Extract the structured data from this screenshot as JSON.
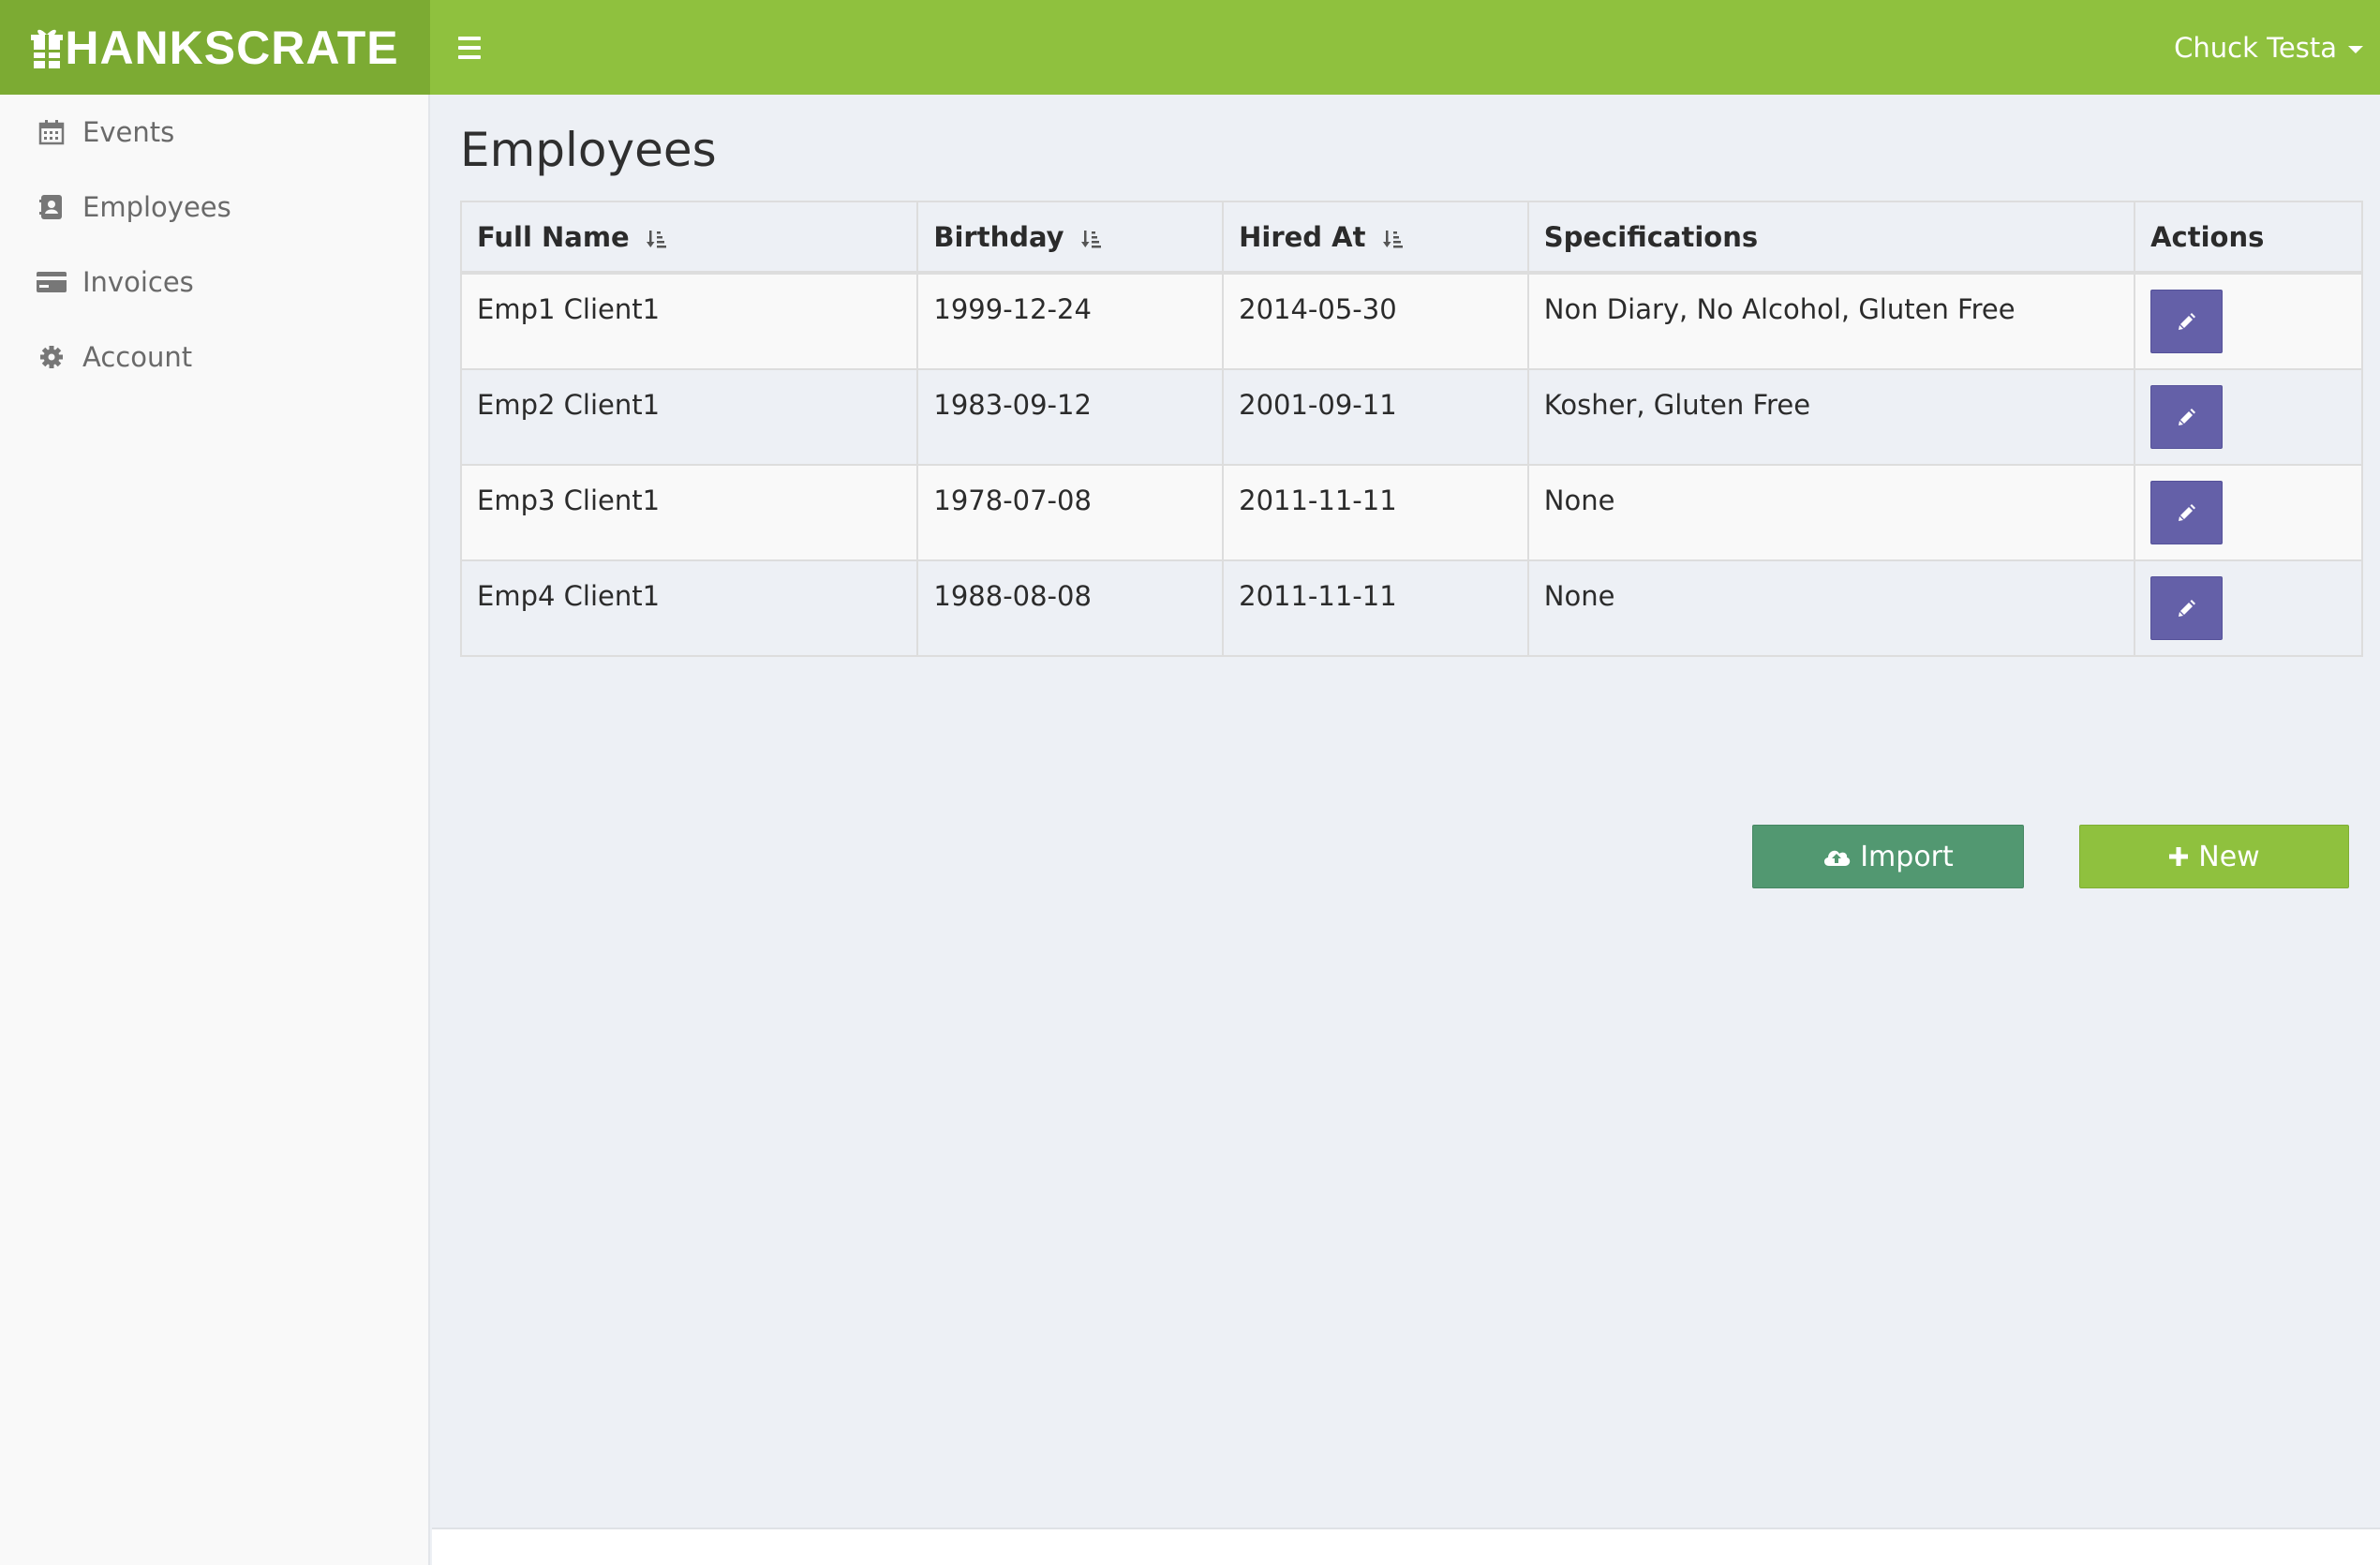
{
  "brand": {
    "name": "HANKSCRATE",
    "color": "#8fc13e"
  },
  "header": {
    "user_name": "Chuck Testa"
  },
  "sidebar": {
    "items": [
      {
        "label": "Events",
        "icon": "calendar-icon"
      },
      {
        "label": "Employees",
        "icon": "contact-book-icon"
      },
      {
        "label": "Invoices",
        "icon": "credit-card-icon"
      },
      {
        "label": "Account",
        "icon": "gear-icon"
      }
    ]
  },
  "main": {
    "title": "Employees",
    "table": {
      "headers": [
        "Full Name",
        "Birthday",
        "Hired At",
        "Specifications",
        "Actions"
      ],
      "rows": [
        {
          "name": "Emp1 Client1",
          "birthday": "1999-12-24",
          "hired": "2014-05-30",
          "specs": "Non Diary, No Alcohol, Gluten Free"
        },
        {
          "name": "Emp2 Client1",
          "birthday": "1983-09-12",
          "hired": "2001-09-11",
          "specs": "Kosher, Gluten Free"
        },
        {
          "name": "Emp3 Client1",
          "birthday": "1978-07-08",
          "hired": "2011-11-11",
          "specs": "None"
        },
        {
          "name": "Emp4 Client1",
          "birthday": "1988-08-08",
          "hired": "2011-11-11",
          "specs": "None"
        }
      ]
    },
    "buttons": {
      "import_label": "Import",
      "new_label": "New"
    }
  },
  "colors": {
    "header": "#8fc13e",
    "logo_bg": "#7cab33",
    "edit": "#6460a8",
    "import": "#529871",
    "new": "#8fc13e"
  }
}
